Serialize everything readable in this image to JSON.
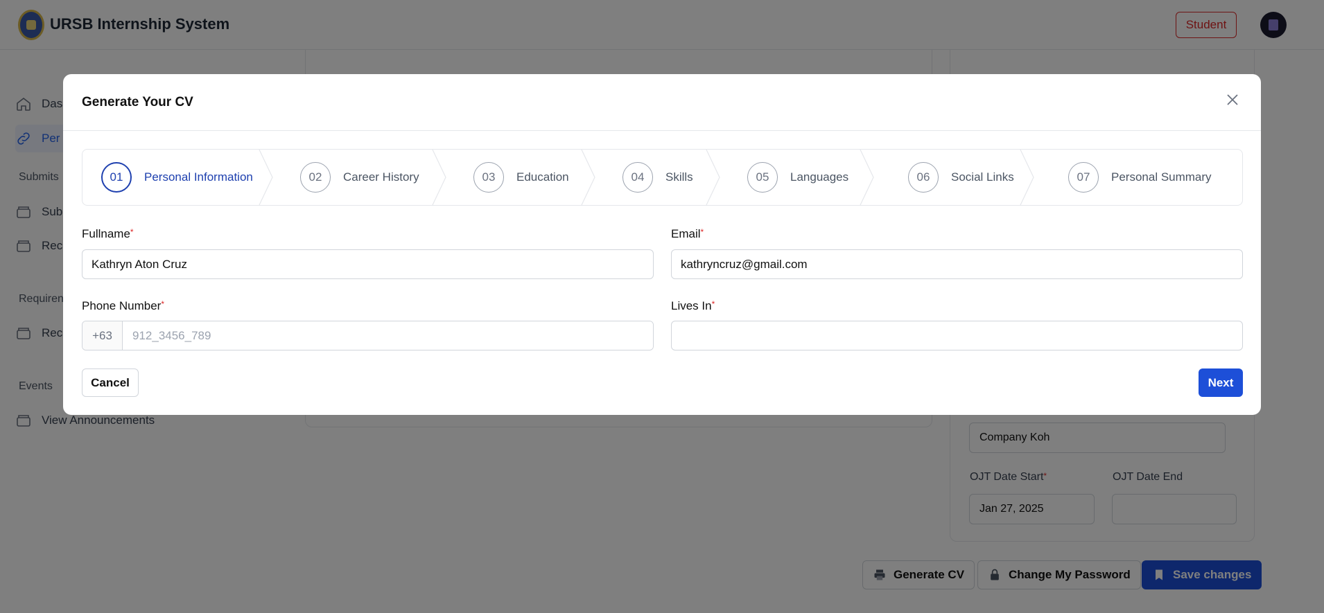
{
  "app": {
    "title": "URSB Internship System",
    "role_badge": "Student"
  },
  "sidebar": {
    "items": [
      {
        "label": "Das"
      },
      {
        "label": "Per"
      },
      {
        "label": "Sub"
      },
      {
        "label": "Rec"
      },
      {
        "label": "Rec"
      },
      {
        "label": "View Announcements"
      }
    ],
    "headings": {
      "submits": "Submits",
      "requirements": "Requiren",
      "events": "Events"
    }
  },
  "background_form": {
    "company_value": "Company Koh",
    "ojt_start_label": "OJT Date Start",
    "ojt_start_value": "Jan 27, 2025",
    "ojt_end_label": "OJT Date End"
  },
  "footer_buttons": {
    "generate_cv": "Generate CV",
    "change_password": "Change My Password",
    "save_changes": "Save changes"
  },
  "modal": {
    "title": "Generate Your CV",
    "steps": [
      {
        "num": "01",
        "label": "Personal Information"
      },
      {
        "num": "02",
        "label": "Career History"
      },
      {
        "num": "03",
        "label": "Education"
      },
      {
        "num": "04",
        "label": "Skills"
      },
      {
        "num": "05",
        "label": "Languages"
      },
      {
        "num": "06",
        "label": "Social Links"
      },
      {
        "num": "07",
        "label": "Personal Summary"
      }
    ],
    "active_step": "01",
    "fields": {
      "fullname_label": "Fullname",
      "fullname_value": "Kathryn Aton Cruz",
      "email_label": "Email",
      "email_value": "kathryncruz@gmail.com",
      "phone_label": "Phone Number",
      "phone_prefix": "+63",
      "phone_placeholder": "912_3456_789",
      "lives_in_label": "Lives In",
      "lives_in_value": ""
    },
    "required_mark": "*",
    "cancel_label": "Cancel",
    "next_label": "Next"
  },
  "colors": {
    "accent": "#1d4fd8",
    "active_step": "#1e40af",
    "required": "#dc2626"
  }
}
